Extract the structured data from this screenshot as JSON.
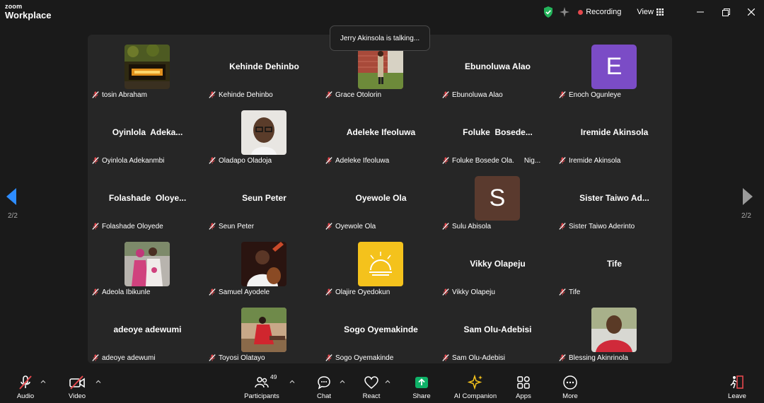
{
  "brand": {
    "line1": "zoom",
    "line2": "Workplace"
  },
  "titlebar": {
    "recording_label": "Recording",
    "view_label": "View"
  },
  "toast": "Jerry Akinsola is talking...",
  "pagination": {
    "left": "2/2",
    "right": "2/2"
  },
  "colors": {
    "accent": "#0e72ed",
    "recording": "#e5484d",
    "muted": "#e5484d",
    "share": "#0fb268",
    "stage": "#262626"
  },
  "participants": [
    {
      "big_name": "",
      "label": "tosin Abraham",
      "photo": "fireplace"
    },
    {
      "big_name": "Kehinde Dehinbo",
      "label": "Kehinde Dehinbo"
    },
    {
      "big_name": "",
      "label": "Grace Otolorin",
      "photo": "brick-person"
    },
    {
      "big_name": "Ebunoluwa Alao",
      "label": "Ebunoluwa Alao"
    },
    {
      "big_name": "",
      "label": "Enoch Ogunleye",
      "letter": "E",
      "letter_color": "#7b4cc6"
    },
    {
      "big_name": "Oyinlola  Adeka...",
      "label": "Oyinlola Adekanmbi"
    },
    {
      "big_name": "",
      "label": "Oladapo Oladoja",
      "photo": "man-glasses"
    },
    {
      "big_name": "Adeleke Ifeoluwa",
      "label": "Adeleke Ifeoluwa"
    },
    {
      "big_name": "Foluke  Bosede...",
      "label": "Foluke Bosede Ola.",
      "label_extra": "Nig..."
    },
    {
      "big_name": "Iremide Akinsola",
      "label": "Iremide Akinsola"
    },
    {
      "big_name": "Folashade  Oloye...",
      "label": "Folashade Oloyede"
    },
    {
      "big_name": "Seun Peter",
      "label": "Seun Peter"
    },
    {
      "big_name": "Oyewole Ola",
      "label": "Oyewole Ola"
    },
    {
      "big_name": "",
      "label": "Sulu Abisola",
      "letter": "S",
      "letter_color": "#5a3a2e"
    },
    {
      "big_name": "Sister Taiwo Ad...",
      "label": "Sister Taiwo Aderinto"
    },
    {
      "big_name": "",
      "label": "Adeola Ibikunle",
      "photo": "couple"
    },
    {
      "big_name": "",
      "label": "Samuel Ayodele",
      "photo": "guitarist"
    },
    {
      "big_name": "",
      "label": "Olajire Oyedokun",
      "photo": "yellow-logo"
    },
    {
      "big_name": "Vikky Olapeju",
      "label": "Vikky Olapeju"
    },
    {
      "big_name": "Tife",
      "label": "Tife"
    },
    {
      "big_name": "adeoye adewumi",
      "label": "adeoye adewumi"
    },
    {
      "big_name": "",
      "label": "Toyosi Olatayo",
      "photo": "woman-red"
    },
    {
      "big_name": "Sogo Oyemakinde",
      "label": "Sogo Oyemakinde"
    },
    {
      "big_name": "Sam Olu-Adebisi",
      "label": "Sam Olu-Adebisi"
    },
    {
      "big_name": "",
      "label": "Blessing Akinrinola",
      "photo": "man-red"
    }
  ],
  "toolbar": {
    "audio": "Audio",
    "video": "Video",
    "participants": "Participants",
    "participants_count": "49",
    "chat": "Chat",
    "react": "React",
    "share": "Share",
    "ai_companion": "AI Companion",
    "apps": "Apps",
    "more": "More",
    "leave": "Leave"
  }
}
